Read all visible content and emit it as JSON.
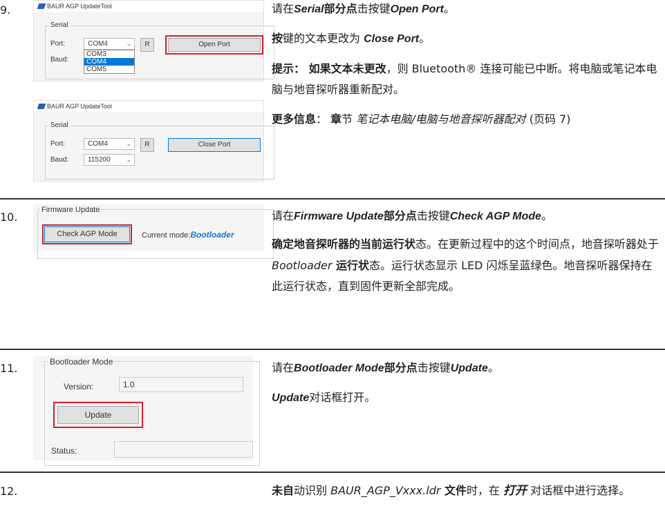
{
  "steps": {
    "s9": {
      "num": "9.",
      "app_title": "BAUR AGP UpdateTool",
      "serial_label": "Serial",
      "port_label": "Port:",
      "baud_label": "Baud:",
      "port_value": "COM4",
      "r_button": "R",
      "open_port_button": "Open Port",
      "close_port_button": "Close Port",
      "baud_value": "115200",
      "dropdown_options": [
        "COM3",
        "COM4",
        "COM5"
      ],
      "text1_a": "请在",
      "text1_b": "Serial",
      "text1_c": "部分点",
      "text1_d": "击按键",
      "text1_e": "Open Port",
      "text1_f": "。",
      "text2_a": "按",
      "text2_b": "键的文本更改为 ",
      "text2_c": "Close Port",
      "text2_d": "。",
      "hint_a": "提示：",
      "hint_b": " 如果文本未更改",
      "hint_c": "，则 Bluetooth® 连接可能已中断。将电脑或笔记本电脑与地音探听器重新配对。",
      "more_a": "更多信息",
      "more_b": "： ",
      "more_c": "章",
      "more_d": "节 ",
      "more_e": "笔记本电脑/电脑与地音探听器配对",
      "more_f": " (页码 7)"
    },
    "s10": {
      "num": "10.",
      "group_label": "Firmware Update",
      "check_button": "Check AGP Mode",
      "current_mode_label": "Current mode:",
      "current_mode_value": "Bootloader",
      "text1_a": "请在",
      "text1_b": "Firmware Update",
      "text1_c": "部分点",
      "text1_d": "击按键",
      "text1_e": "Check AGP Mode",
      "text1_f": "。",
      "text2_a": "确定地音探听器的当前运行状",
      "text2_b": "态。在更新过程中的这个时间点，地音探听器处于 ",
      "text2_c": "Bootloader",
      "text2_d": " 运行状",
      "text2_e": "态。运行状态显示 LED 闪烁呈蓝绿色。地音探听器保持在此运行状态，直到固件更新全部完成。"
    },
    "s11": {
      "num": "11.",
      "group_label": "Bootloader Mode",
      "version_label": "Version:",
      "version_value": "1.0",
      "update_button": "Update",
      "status_label": "Status:",
      "text1_a": "请在",
      "text1_b": "Bootloader Mode",
      "text1_c": "部分点",
      "text1_d": "击按键",
      "text1_e": "Update",
      "text1_f": "。",
      "text2_a": "Update",
      "text2_b": "对话框打开。"
    },
    "s12": {
      "num": "12.",
      "text_a": "未自",
      "text_b": "动识别 ",
      "text_c": "BAUR_AGP_Vxxx.ldr",
      "text_d": " 文件",
      "text_e": "时，在 ",
      "text_f": "打开",
      "text_g": " 对话框中进行选择。"
    }
  },
  "colors": {
    "highlight_red": "#d21f2b",
    "active_blue": "#0078d7",
    "mode_blue": "#1e73d2"
  }
}
